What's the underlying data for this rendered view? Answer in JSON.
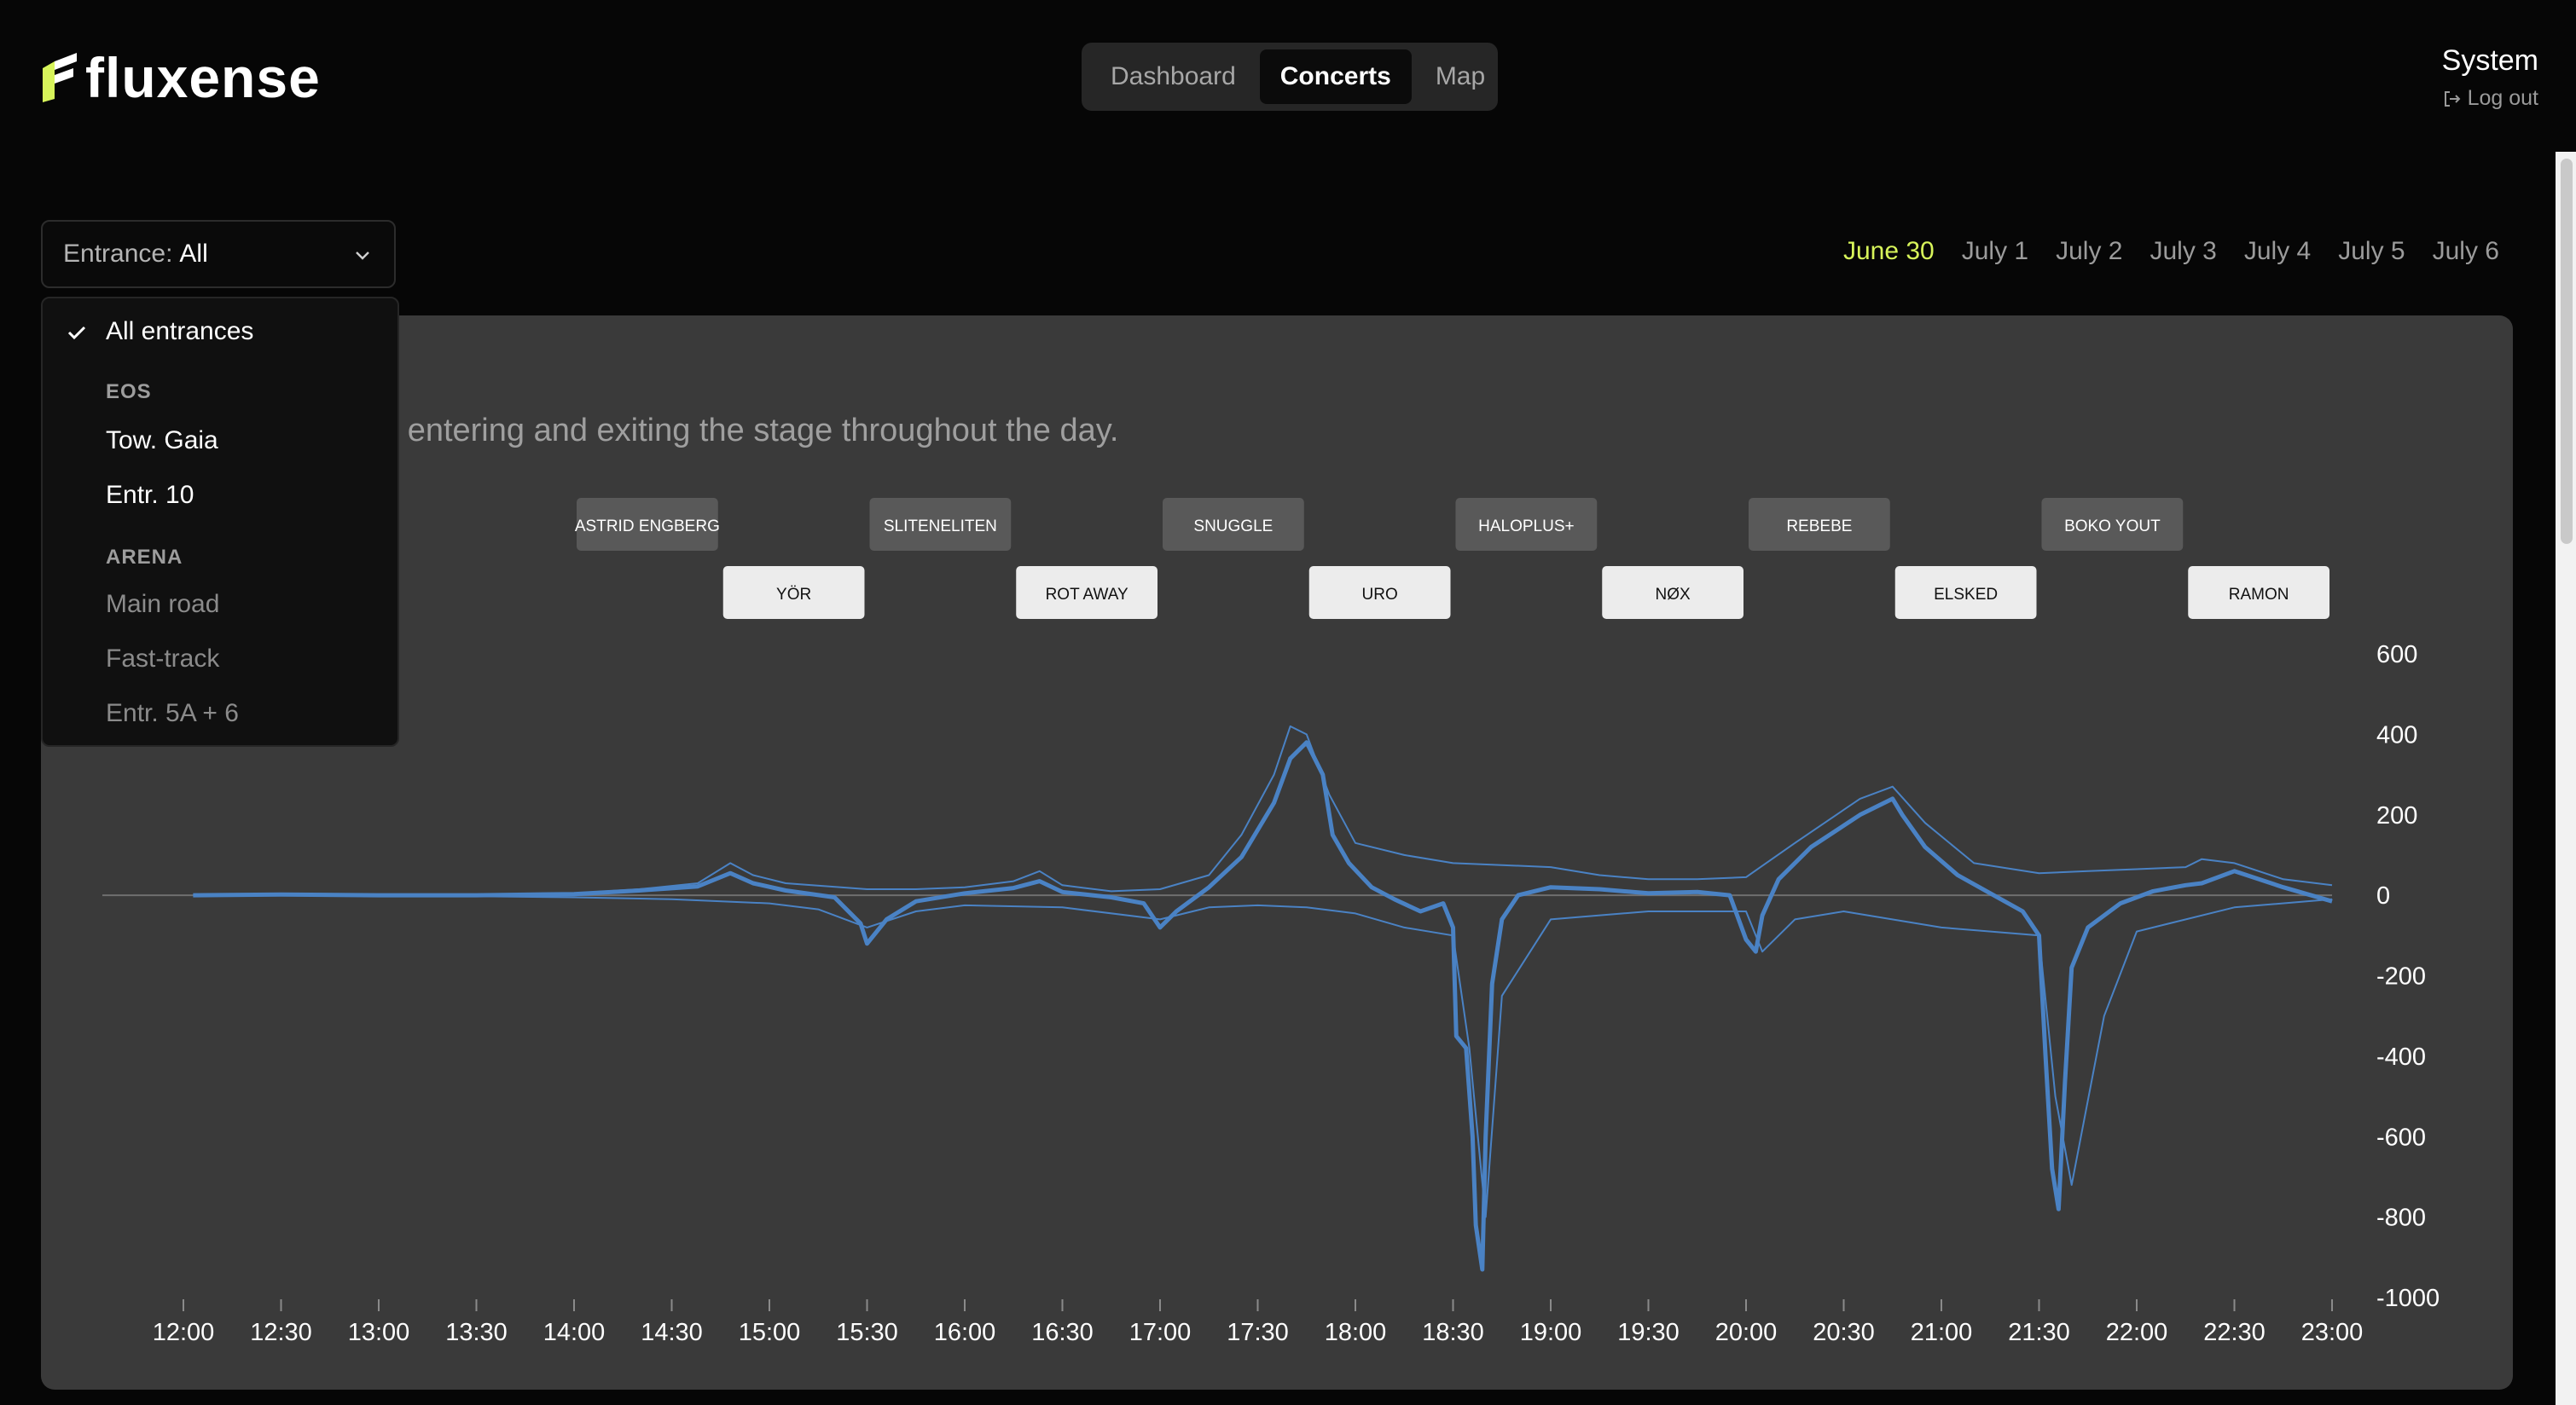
{
  "header": {
    "logo": "fluxense",
    "nav": [
      {
        "label": "Dashboard",
        "active": false
      },
      {
        "label": "Concerts",
        "active": true
      },
      {
        "label": "Map",
        "active": false
      }
    ],
    "user": {
      "name": "System",
      "logout_label": "Log out"
    }
  },
  "filter": {
    "label": "Entrance:",
    "value": "All",
    "menu": {
      "all_label": "All entrances",
      "groups": [
        {
          "name": "EOS",
          "items": [
            {
              "label": "Tow. Gaia",
              "enabled": true
            },
            {
              "label": "Entr. 10",
              "enabled": true
            }
          ]
        },
        {
          "name": "ARENA",
          "items": [
            {
              "label": "Main road",
              "enabled": false
            },
            {
              "label": "Fast-track",
              "enabled": false
            },
            {
              "label": "Entr. 5A + 6",
              "enabled": false
            }
          ]
        }
      ]
    }
  },
  "dates": [
    {
      "label": "June 30",
      "active": true
    },
    {
      "label": "July 1",
      "active": false
    },
    {
      "label": "July 2",
      "active": false
    },
    {
      "label": "July 3",
      "active": false
    },
    {
      "label": "July 4",
      "active": false
    },
    {
      "label": "July 5",
      "active": false
    },
    {
      "label": "July 6",
      "active": false
    }
  ],
  "card": {
    "subtitle": "e entering and exiting the stage throughout the day."
  },
  "colors": {
    "accent": "#d7f45a",
    "series": "#4a82c4",
    "card_bg": "#3a3a3a",
    "concert_past": "#595959",
    "concert_upcoming": "#ececec"
  },
  "chart_data": {
    "type": "line",
    "x_type": "time",
    "xlim": [
      "12:00",
      "23:00"
    ],
    "ylim": [
      -1000,
      600
    ],
    "xticks": [
      "12:00",
      "12:30",
      "13:00",
      "13:30",
      "14:00",
      "14:30",
      "15:00",
      "15:30",
      "16:00",
      "16:30",
      "17:00",
      "17:30",
      "18:00",
      "18:30",
      "19:00",
      "19:30",
      "20:00",
      "20:30",
      "21:00",
      "21:30",
      "22:00",
      "22:30",
      "23:00"
    ],
    "yticks": [
      600,
      400,
      200,
      0,
      -200,
      -400,
      -600,
      -800,
      -1000
    ],
    "zero_line": true,
    "concerts": [
      {
        "name": "ASTRID ENGBERG",
        "start": "14:00",
        "end": "14:45",
        "row": 1
      },
      {
        "name": "YÖR",
        "start": "14:45",
        "end": "15:30",
        "row": 2
      },
      {
        "name": "SLITENELITEN",
        "start": "15:30",
        "end": "16:15",
        "row": 1
      },
      {
        "name": "ROT AWAY",
        "start": "16:15",
        "end": "17:00",
        "row": 2
      },
      {
        "name": "SNUGGLE",
        "start": "17:00",
        "end": "17:45",
        "row": 1
      },
      {
        "name": "URO",
        "start": "17:45",
        "end": "18:30",
        "row": 2
      },
      {
        "name": "HALOPLUS+",
        "start": "18:30",
        "end": "19:15",
        "row": 1
      },
      {
        "name": "NØX",
        "start": "19:15",
        "end": "20:00",
        "row": 2
      },
      {
        "name": "REBEBE",
        "start": "20:00",
        "end": "20:45",
        "row": 1
      },
      {
        "name": "ELSKED",
        "start": "20:45",
        "end": "21:30",
        "row": 2
      },
      {
        "name": "BOKO YOUT",
        "start": "21:30",
        "end": "22:15",
        "row": 1
      },
      {
        "name": "RAMON",
        "start": "22:15",
        "end": "23:00",
        "row": 2
      }
    ],
    "series": [
      {
        "role": "net",
        "x": [
          "12:03",
          "12:30",
          "13:00",
          "13:30",
          "14:00",
          "14:20",
          "14:38",
          "14:48",
          "14:55",
          "15:05",
          "15:20",
          "15:28",
          "15:30",
          "15:36",
          "15:45",
          "16:00",
          "16:15",
          "16:23",
          "16:30",
          "16:45",
          "16:55",
          "17:00",
          "17:05",
          "17:15",
          "17:25",
          "17:35",
          "17:40",
          "17:45",
          "17:50",
          "17:53",
          "17:58",
          "18:05",
          "18:12",
          "18:20",
          "18:27",
          "18:30",
          "18:31",
          "18:34",
          "18:36",
          "18:37",
          "18:39",
          "18:40",
          "18:42",
          "18:45",
          "18:50",
          "19:00",
          "19:15",
          "19:30",
          "19:45",
          "19:55",
          "20:00",
          "20:03",
          "20:05",
          "20:10",
          "20:20",
          "20:35",
          "20:45",
          "20:48",
          "20:55",
          "21:05",
          "21:15",
          "21:25",
          "21:30",
          "21:32",
          "21:34",
          "21:36",
          "21:38",
          "21:40",
          "21:45",
          "21:55",
          "22:05",
          "22:15",
          "22:20",
          "22:30",
          "22:45",
          "23:00"
        ],
        "y": [
          0,
          2,
          0,
          0,
          3,
          12,
          22,
          55,
          30,
          12,
          -5,
          -70,
          -120,
          -60,
          -15,
          5,
          18,
          35,
          8,
          -5,
          -20,
          -80,
          -40,
          20,
          95,
          230,
          340,
          380,
          300,
          150,
          80,
          20,
          -10,
          -40,
          -20,
          -80,
          -350,
          -380,
          -600,
          -820,
          -930,
          -600,
          -220,
          -60,
          0,
          20,
          15,
          5,
          8,
          0,
          -110,
          -140,
          -50,
          40,
          120,
          200,
          240,
          200,
          120,
          50,
          5,
          -40,
          -100,
          -400,
          -680,
          -780,
          -460,
          -180,
          -80,
          -20,
          10,
          25,
          30,
          60,
          20,
          -15
        ]
      },
      {
        "role": "in",
        "x": [
          "12:03",
          "13:00",
          "14:00",
          "14:20",
          "14:38",
          "14:48",
          "14:55",
          "15:05",
          "15:30",
          "15:45",
          "16:00",
          "16:15",
          "16:23",
          "16:30",
          "16:45",
          "17:00",
          "17:15",
          "17:25",
          "17:35",
          "17:40",
          "17:45",
          "17:52",
          "18:00",
          "18:15",
          "18:30",
          "18:45",
          "19:00",
          "19:15",
          "19:30",
          "19:45",
          "20:00",
          "20:15",
          "20:35",
          "20:45",
          "20:55",
          "21:10",
          "21:30",
          "21:45",
          "22:00",
          "22:15",
          "22:20",
          "22:30",
          "22:45",
          "23:00"
        ],
        "y": [
          0,
          0,
          5,
          15,
          30,
          80,
          50,
          30,
          15,
          15,
          20,
          35,
          60,
          25,
          10,
          15,
          50,
          150,
          300,
          420,
          400,
          250,
          130,
          100,
          80,
          75,
          70,
          50,
          40,
          40,
          45,
          130,
          240,
          270,
          180,
          80,
          55,
          60,
          65,
          70,
          90,
          80,
          40,
          25
        ]
      },
      {
        "role": "out",
        "x": [
          "12:03",
          "13:00",
          "14:00",
          "14:30",
          "15:00",
          "15:15",
          "15:30",
          "15:45",
          "16:00",
          "16:30",
          "17:00",
          "17:15",
          "17:30",
          "17:45",
          "18:00",
          "18:15",
          "18:30",
          "18:35",
          "18:40",
          "18:45",
          "19:00",
          "19:30",
          "20:00",
          "20:05",
          "20:15",
          "20:30",
          "21:00",
          "21:30",
          "21:35",
          "21:40",
          "21:50",
          "22:00",
          "22:30",
          "23:00"
        ],
        "y": [
          0,
          0,
          -5,
          -10,
          -20,
          -35,
          -80,
          -40,
          -25,
          -30,
          -60,
          -30,
          -25,
          -30,
          -45,
          -80,
          -100,
          -380,
          -800,
          -250,
          -60,
          -40,
          -40,
          -140,
          -60,
          -40,
          -80,
          -100,
          -500,
          -720,
          -300,
          -90,
          -30,
          -10
        ]
      }
    ]
  }
}
